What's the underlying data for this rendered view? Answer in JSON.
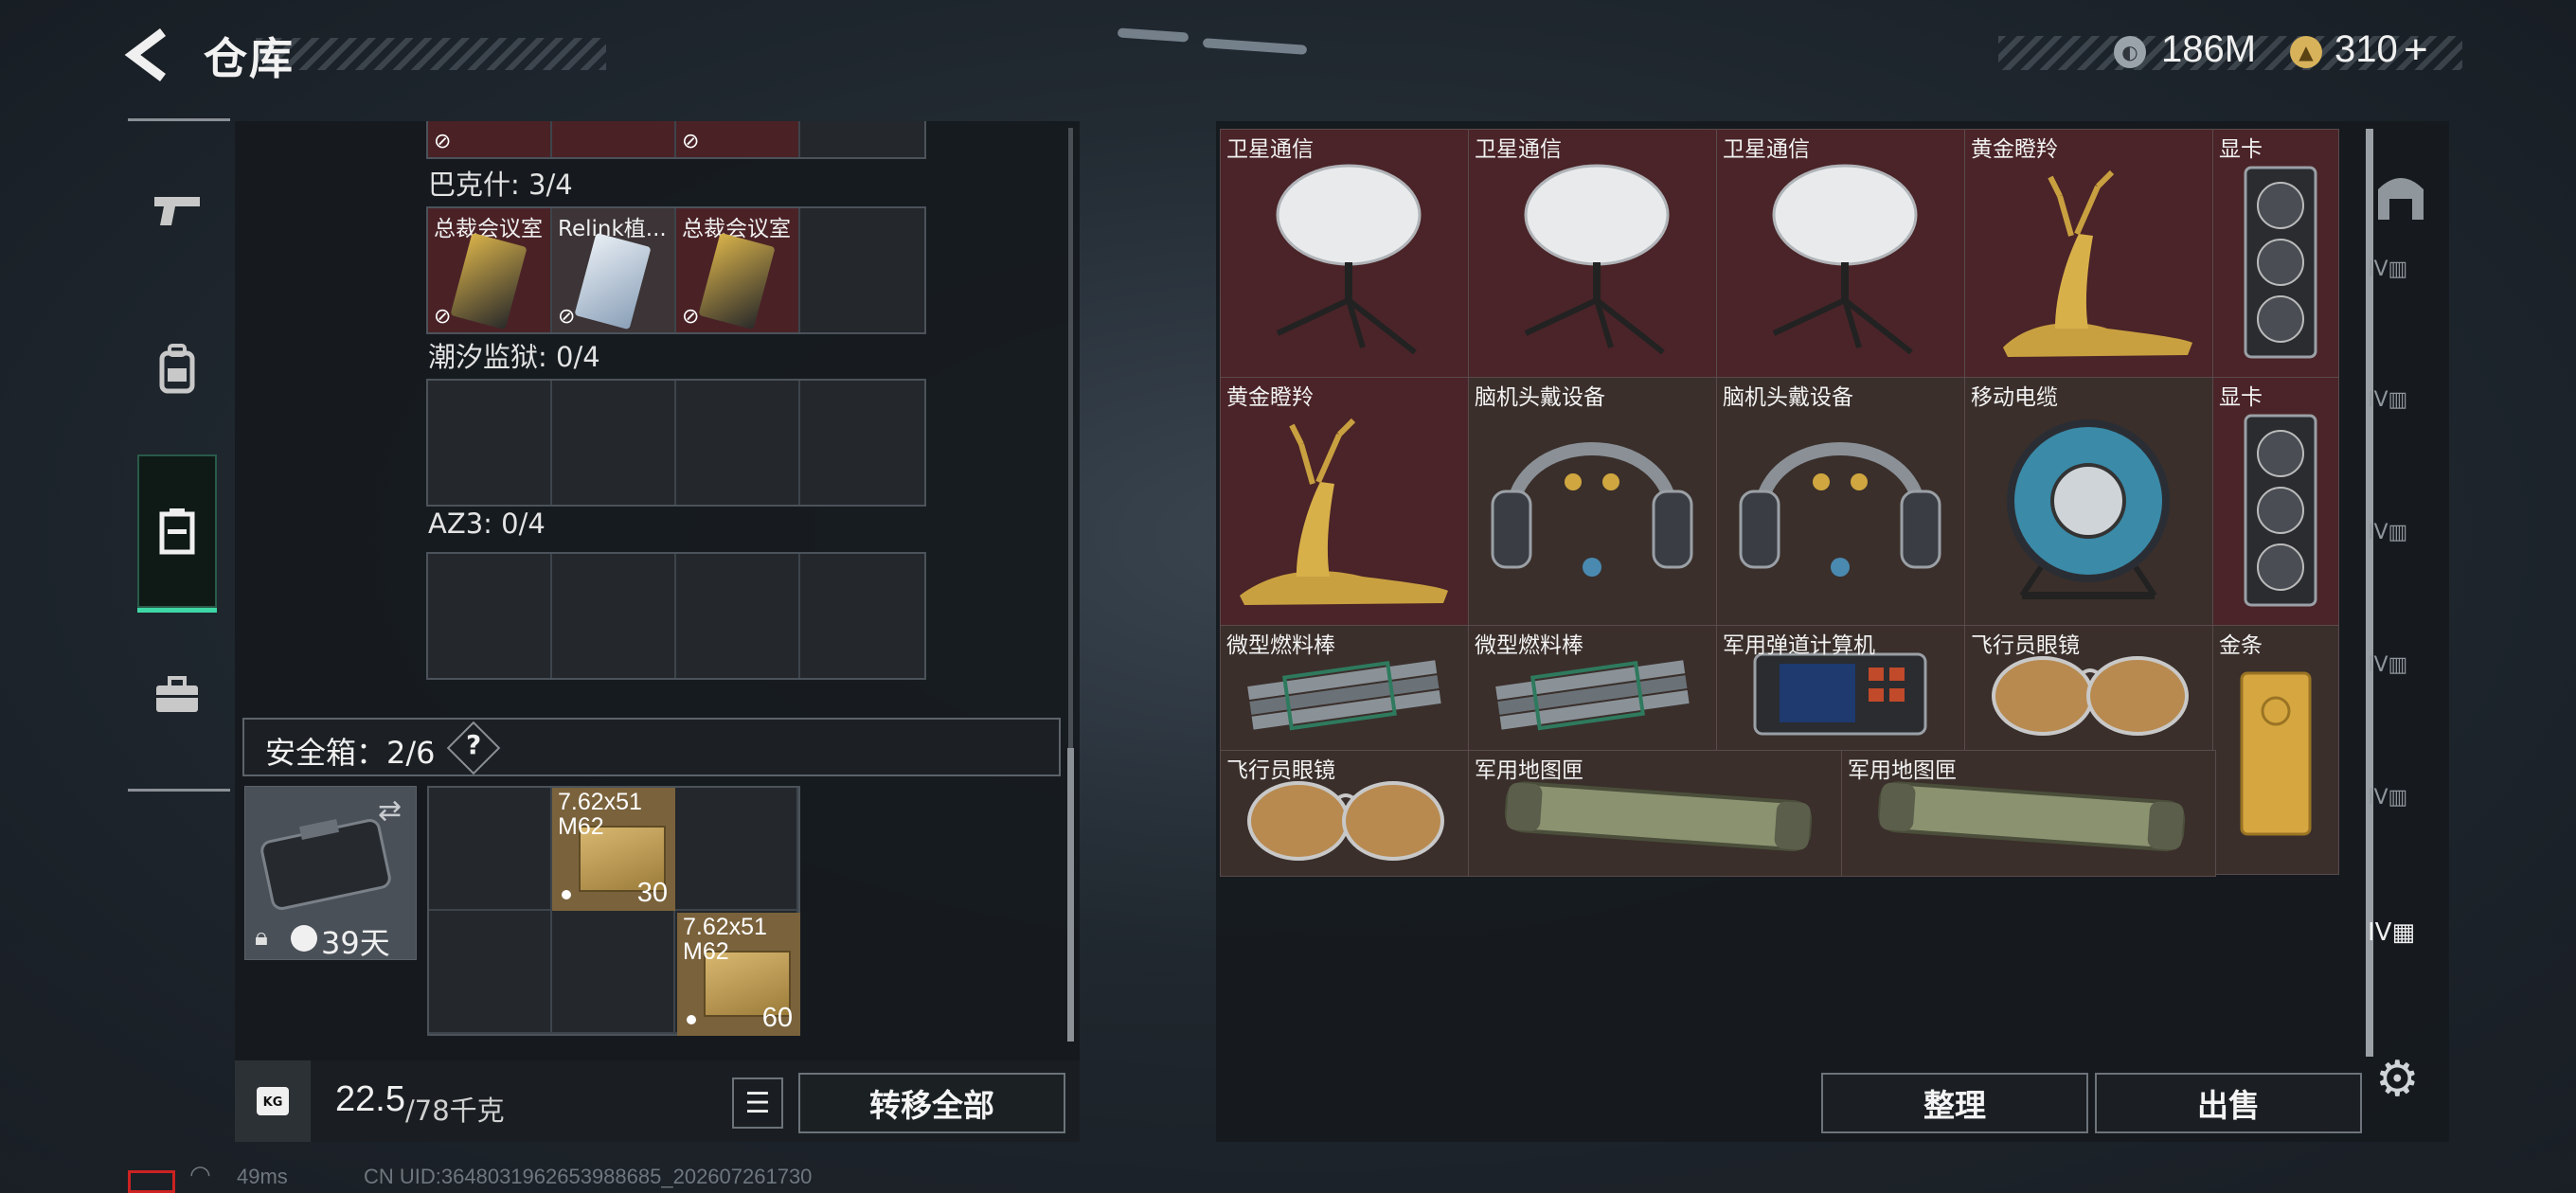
{
  "header": {
    "title": "仓库",
    "back_icon": "chevron-left-icon"
  },
  "currency": {
    "silver": "186M",
    "gold": "310",
    "gold_plus": "+"
  },
  "left_nav": [
    {
      "name": "weapon",
      "icon": "pistol-icon"
    },
    {
      "name": "equipment",
      "icon": "backpack-icon"
    },
    {
      "name": "container",
      "icon": "case-icon",
      "active": true
    },
    {
      "name": "briefcase",
      "icon": "briefcase-icon"
    }
  ],
  "groups": [
    {
      "label": "巴克什: 3/4",
      "slots": [
        {
          "label": "总裁会议室",
          "color": "red"
        },
        {
          "label": "Relink植...",
          "color": "red"
        },
        {
          "label": "总裁会议室",
          "color": "red"
        },
        {
          "label": "",
          "color": "empty"
        }
      ]
    },
    {
      "label": "潮汐监狱: 0/4"
    },
    {
      "label": "AZ3: 0/4"
    }
  ],
  "safe_box": {
    "label": "安全箱：2/6",
    "help": "?",
    "timer": "39天",
    "ammo": [
      {
        "name_line1": "7.62x51",
        "name_line2": "M62",
        "count": "30"
      },
      {
        "name_line1": "7.62x51",
        "name_line2": "M62",
        "count": "60"
      }
    ]
  },
  "weight": {
    "current": "22.5",
    "max": "/78千克",
    "icon_label": "KG"
  },
  "buttons": {
    "transfer_all": "转移全部",
    "organize": "整理",
    "sell": "出售"
  },
  "stash_items": [
    {
      "label": "卫星通信",
      "kind": "satellite"
    },
    {
      "label": "卫星通信",
      "kind": "satellite"
    },
    {
      "label": "卫星通信",
      "kind": "satellite"
    },
    {
      "label": "黄金瞪羚",
      "kind": "gazelle"
    },
    {
      "label": "显卡",
      "kind": "gpu"
    },
    {
      "label": "黄金瞪羚",
      "kind": "gazelle"
    },
    {
      "label": "脑机头戴设备",
      "kind": "headset"
    },
    {
      "label": "脑机头戴设备",
      "kind": "headset"
    },
    {
      "label": "移动电缆",
      "kind": "cable"
    },
    {
      "label": "显卡",
      "kind": "gpu"
    },
    {
      "label": "微型燃料棒",
      "kind": "fuel"
    },
    {
      "label": "微型燃料棒",
      "kind": "fuel"
    },
    {
      "label": "军用弹道计算机",
      "kind": "computer"
    },
    {
      "label": "飞行员眼镜",
      "kind": "glasses"
    },
    {
      "label": "金条",
      "kind": "gold"
    },
    {
      "label": "飞行员眼镜",
      "kind": "glasses"
    },
    {
      "label": "军用地图匣",
      "kind": "tube"
    },
    {
      "label": "军用地图匣",
      "kind": "tube"
    }
  ],
  "right_side_icons": [
    "filter-icon",
    "tab-iv-icon",
    "tab-iv-icon",
    "tab-iv-icon",
    "tab-iv-icon",
    "tab-iv-icon",
    "tab-iv-active-icon"
  ],
  "status_bar": {
    "ping": "49ms",
    "uid": "CN UID:3648031962653988685_202607261730"
  }
}
